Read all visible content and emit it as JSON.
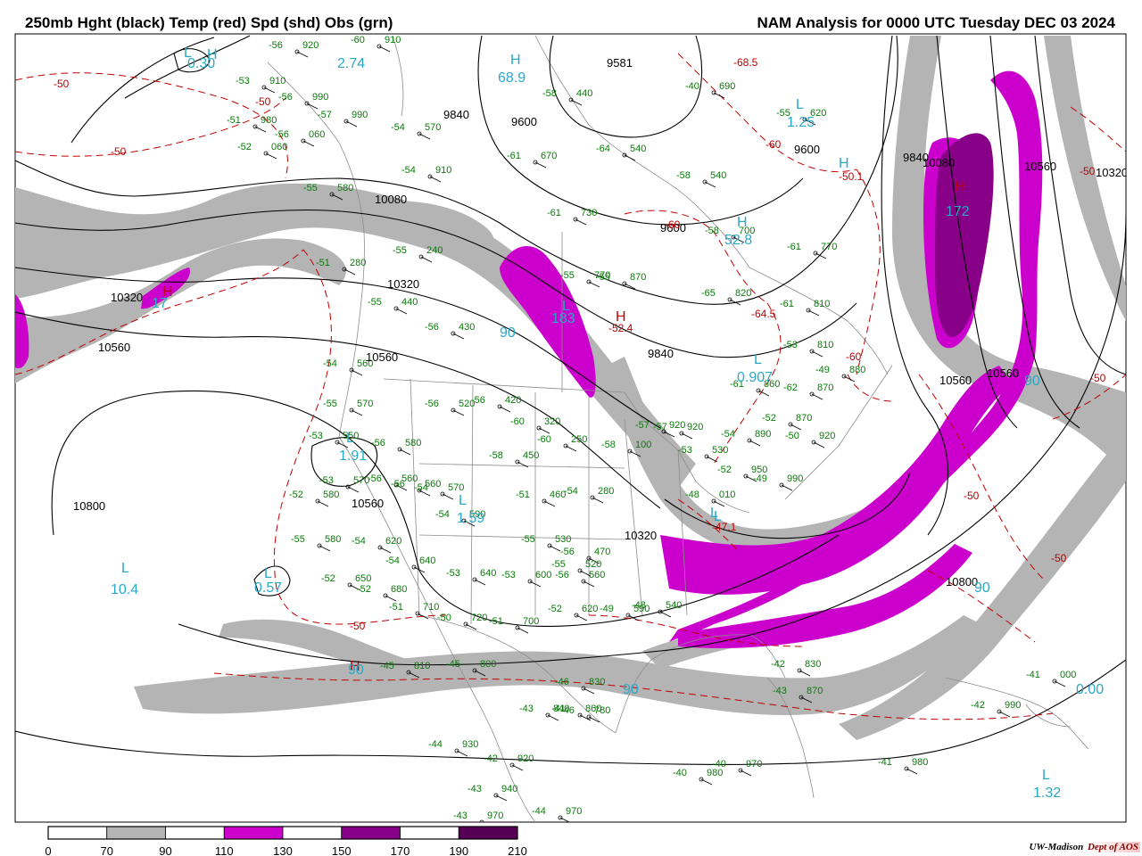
{
  "header": {
    "title": "250mb Hght (black) Temp (red) Spd (shd) Obs (grn)",
    "analysis": "NAM Analysis for 0000 UTC Tuesday  DEC 03 2024"
  },
  "colors": {
    "height": "#000000",
    "temp": "#c00000",
    "obs": "#0a7a0a",
    "center": "#29a9c8",
    "spd_70": "#b4b4b4",
    "spd_110": "#cc00cc",
    "spd_150": "#880088",
    "spd_190": "#550055",
    "border": "#8c8c8c"
  },
  "legend": {
    "ticks": [
      "0",
      "70",
      "90",
      "110",
      "130",
      "150",
      "170",
      "190",
      "210"
    ],
    "fills": [
      "#ffffff",
      "#b4b4b4",
      "#ffffff",
      "#cc00cc",
      "#ffffff",
      "#880088",
      "#ffffff",
      "#550055"
    ]
  },
  "height_labels": [
    "9581",
    "9840",
    "9600",
    "9840",
    "9600",
    "9600",
    "10080",
    "10320",
    "10320",
    "10560",
    "10560",
    "9840",
    "10320",
    "10560",
    "10800",
    "10560",
    "10800",
    "10080",
    "10560",
    "10560",
    "10320"
  ],
  "temp_labels": [
    "-50",
    "-50",
    "-50",
    "-50",
    "-60",
    "-60",
    "-60",
    "-68.5",
    "-64.5",
    "-52.4",
    "-47.1",
    "-50.1",
    "-50",
    "-50",
    "-50",
    "-50"
  ],
  "center_labels": [
    "L",
    "H",
    "L",
    "H",
    "L",
    "H",
    "L",
    "H",
    "L",
    "L",
    "L",
    "L",
    "L",
    "H",
    "H",
    "L",
    "H",
    "L",
    "H",
    "L"
  ],
  "center_values": [
    "2.74",
    "68.9",
    "1.25",
    "52.8",
    "0.907",
    "172",
    "183",
    "1.91",
    "1.59",
    "10.4",
    "0.57",
    "17",
    "0.30",
    "0.00",
    "1.32",
    "90",
    "90",
    "90",
    "90",
    "90"
  ],
  "obs": [
    [
      "-56",
      "920"
    ],
    [
      "-60",
      "910"
    ],
    [
      "-53",
      "910"
    ],
    [
      "-56",
      "990"
    ],
    [
      "-51",
      "980"
    ],
    [
      "-57",
      "990"
    ],
    [
      "-54",
      "570"
    ],
    [
      "-56",
      "060"
    ],
    [
      "-52",
      "060"
    ],
    [
      "-55",
      "580"
    ],
    [
      "-61",
      "670"
    ],
    [
      "-64",
      "540"
    ],
    [
      "-58",
      "540"
    ],
    [
      "-58",
      "440"
    ],
    [
      "-54",
      "910"
    ],
    [
      "-61",
      "730"
    ],
    [
      "-58",
      "700"
    ],
    [
      "-61",
      "770"
    ],
    [
      "-51",
      "280"
    ],
    [
      "-55",
      "240"
    ],
    [
      "-55",
      "440"
    ],
    [
      "-56",
      "430"
    ],
    [
      "-55",
      "770"
    ],
    [
      "-65",
      "820"
    ],
    [
      "-61",
      "810"
    ],
    [
      "-54",
      "560"
    ],
    [
      "-55",
      "570"
    ],
    [
      "-56",
      "520"
    ],
    [
      "-56",
      "420"
    ],
    [
      "-61",
      "860"
    ],
    [
      "-53",
      "810"
    ],
    [
      "-49",
      "880"
    ],
    [
      "-62",
      "870"
    ],
    [
      "-53",
      "550"
    ],
    [
      "-56",
      "580"
    ],
    [
      "-56",
      "560"
    ],
    [
      "-58",
      "450"
    ],
    [
      "-60",
      "320"
    ],
    [
      "-60",
      "250"
    ],
    [
      "-57",
      "920"
    ],
    [
      "-54",
      "890"
    ],
    [
      "-52",
      "870"
    ],
    [
      "-50",
      "920"
    ],
    [
      "-53",
      "570"
    ],
    [
      "-56",
      "560"
    ],
    [
      "-54",
      "570"
    ],
    [
      "-54",
      "590"
    ],
    [
      "-52",
      "580"
    ],
    [
      "-51",
      "460"
    ],
    [
      "-54",
      "280"
    ],
    [
      "-58",
      "100"
    ],
    [
      "-57",
      "920"
    ],
    [
      "-53",
      "530"
    ],
    [
      "-52",
      "950"
    ],
    [
      "-49",
      "990"
    ],
    [
      "-48",
      "010"
    ],
    [
      "-55",
      "580"
    ],
    [
      "-54",
      "620"
    ],
    [
      "-55",
      "530"
    ],
    [
      "-56",
      "470"
    ],
    [
      "-55",
      "520"
    ],
    [
      "-52",
      "650"
    ],
    [
      "-54",
      "640"
    ],
    [
      "-53",
      "640"
    ],
    [
      "-52",
      "680"
    ],
    [
      "-53",
      "600"
    ],
    [
      "-56",
      "560"
    ],
    [
      "-51",
      "710"
    ],
    [
      "-50",
      "720"
    ],
    [
      "-51",
      "700"
    ],
    [
      "-52",
      "620"
    ],
    [
      "-49",
      "590"
    ],
    [
      "-48",
      "540"
    ],
    [
      "-45",
      "810"
    ],
    [
      "-45",
      "800"
    ],
    [
      "-46",
      "830"
    ],
    [
      "-46",
      "780"
    ],
    [
      "-42",
      "830"
    ],
    [
      "-43",
      "870"
    ],
    [
      "-43",
      "840"
    ],
    [
      "-41",
      "860"
    ],
    [
      "-44",
      "930"
    ],
    [
      "-42",
      "920"
    ],
    [
      "-43",
      "940"
    ],
    [
      "-43",
      "970"
    ],
    [
      "-44",
      "970"
    ],
    [
      "-40",
      "980"
    ],
    [
      "-40",
      "970"
    ],
    [
      "-41",
      "980"
    ],
    [
      "-42",
      "990"
    ],
    [
      "-41",
      "000"
    ],
    [
      "-40",
      "690"
    ],
    [
      "-55",
      "620"
    ],
    [
      "-55",
      "870"
    ]
  ],
  "footer": {
    "credit_main": "UW-Madison",
    "credit_dept": "Dept of AOS"
  }
}
